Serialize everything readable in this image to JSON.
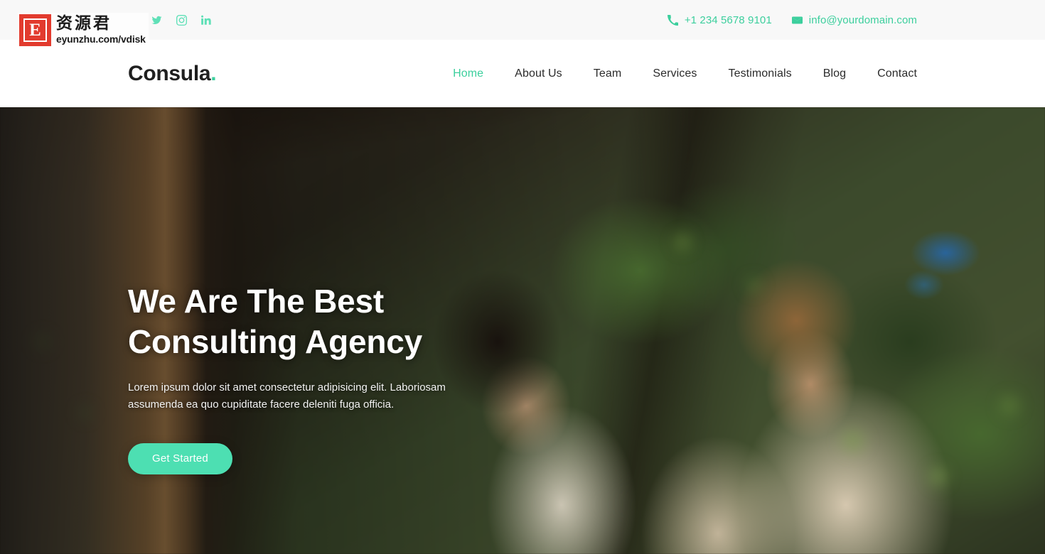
{
  "topbar": {
    "social": [
      {
        "name": "twitter-icon",
        "label": "Twitter"
      },
      {
        "name": "instagram-icon",
        "label": "Instagram"
      },
      {
        "name": "linkedin-icon",
        "label": "LinkedIn"
      }
    ],
    "phone": "+1 234 5678 9101",
    "email": "info@yourdomain.com",
    "phone_icon": "phone-icon",
    "email_icon": "envelope-icon",
    "accent_color": "#3ccf9d",
    "background_color": "#f8f8f8"
  },
  "nav": {
    "brand": "Consula",
    "brand_dot": ".",
    "items": [
      {
        "label": "Home",
        "active": true
      },
      {
        "label": "About Us",
        "active": false
      },
      {
        "label": "Team",
        "active": false
      },
      {
        "label": "Services",
        "active": false
      },
      {
        "label": "Testimonials",
        "active": false
      },
      {
        "label": "Blog",
        "active": false
      },
      {
        "label": "Contact",
        "active": false
      }
    ],
    "active_color": "#3ccf9d",
    "text_color": "#2b2b2b"
  },
  "hero": {
    "title_line1": "We Are The Best",
    "title_line2": "Consulting Agency",
    "subtitle": "Lorem ipsum dolor sit amet consectetur adipisicing elit. Laboriosam assumenda ea quo cupiditate facere deleniti fuga officia.",
    "cta_label": "Get Started",
    "cta_color": "#4ddfb2",
    "title_color": "#ffffff",
    "image_description": "Photograph of a woman and a bearded man seated at a white tiled table by a wooden window with green foliage outside"
  },
  "watermark": {
    "badge_letter": "E",
    "chinese": "资源君",
    "url": "eyunzhu.com/vdisk",
    "badge_color": "#e23b2e"
  }
}
